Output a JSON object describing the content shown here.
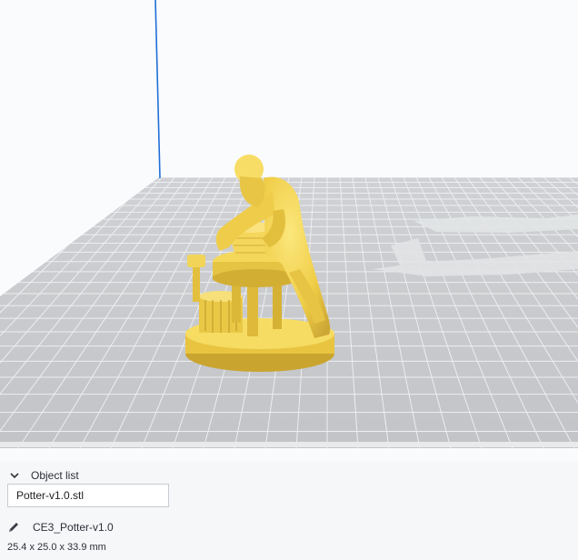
{
  "object_list": {
    "header_label": "Object list",
    "header_icon": "chevron-down-icon",
    "file_name": "Potter-v1.0.stl",
    "job_icon": "pencil-icon",
    "job_name": "CE3_Potter-v1.0",
    "dimensions": "25.4 x 25.0 x 33.9 mm"
  },
  "colors": {
    "build_plate": "#c7c9cc",
    "grid_line": "#eef0f2",
    "model": "#f3d354",
    "model_shadow": "#c7a52e",
    "volume_edge": "#1f6fd8"
  }
}
